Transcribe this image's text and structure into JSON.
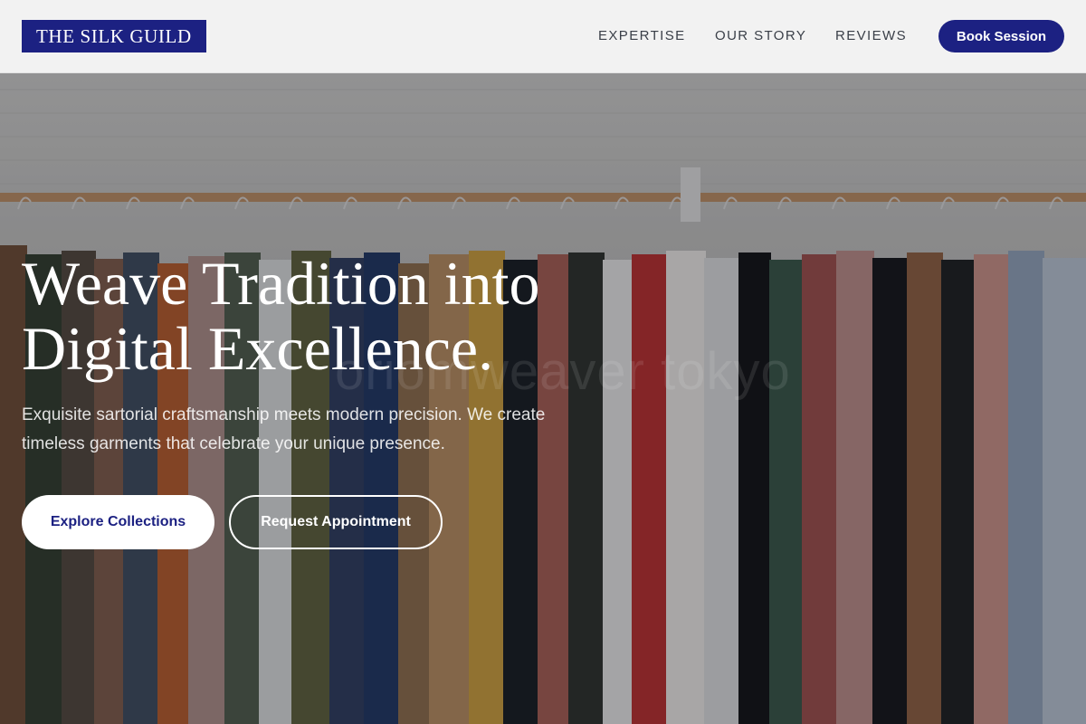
{
  "brand": {
    "logo_text": "THE SILK GUILD",
    "primary_color": "#1c2182"
  },
  "nav": {
    "links": [
      "EXPERTISE",
      "OUR STORY",
      "REVIEWS"
    ],
    "cta_label": "Book Session"
  },
  "hero": {
    "title_line1": "Weave Tradition into",
    "title_line2": "Digital Excellence.",
    "subtitle_line1": "Exquisite sartorial craftsmanship meets modern precision. We create",
    "subtitle_line2": "timeless garments that celebrate your unique presence.",
    "primary_button": "Explore Collections",
    "secondary_button": "Request Appointment",
    "background_image": "clothing rack with shirts and trousers on hangers",
    "watermark_text": "oriomweaver tokyo"
  }
}
